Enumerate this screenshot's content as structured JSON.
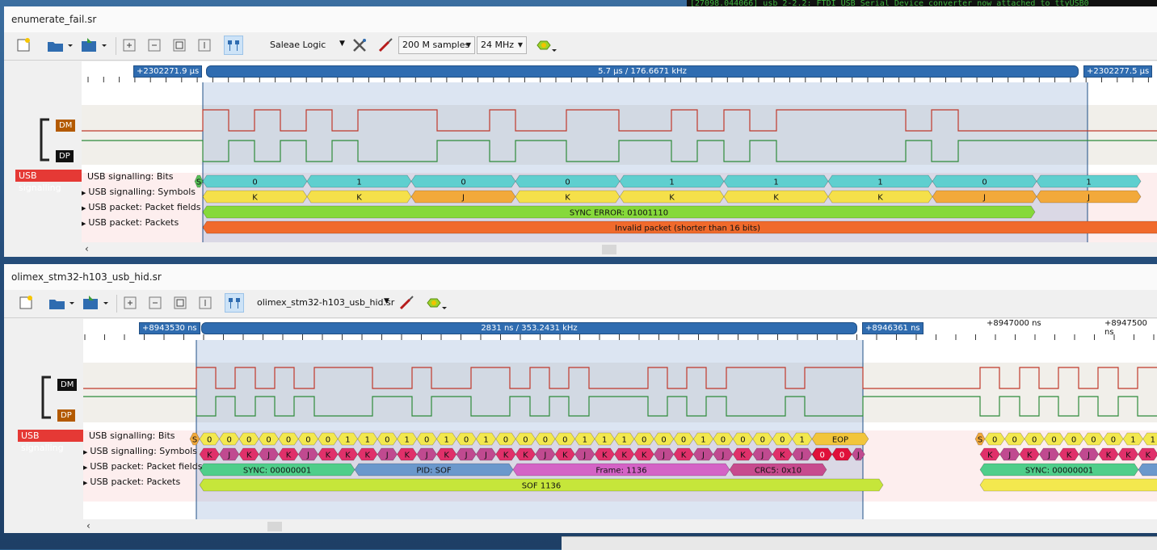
{
  "terminal_text": "[27098.044066] usb 2-2.2: FTDI USB Serial Device converter now attached to ttyUSB0",
  "colors": {
    "bit_fill": "#5fcfcf",
    "sym_k": "#f5e04a",
    "sym_j": "#f2a93b",
    "sync_error": "#86d93a",
    "invalid": "#f06a2c",
    "hid_bit": "#f3e84e",
    "hid_sym": "#c04a90",
    "hid_sym_alt": "#e0306a",
    "f_sync": "#4fce8a",
    "f_pid": "#6b98cc",
    "f_frame": "#d463c6",
    "f_crc": "#c74b8e",
    "f_sof": "#c6e63a",
    "dm_tag": "#b35a00",
    "dp_tag": "#111111",
    "usb_tag": "#e53935"
  },
  "win1": {
    "title": "enumerate_fail.sr",
    "device": "Saleae Logic",
    "samples": "200 M samples",
    "rate": "24 MHz",
    "marker_left": "+2302271.9 µs",
    "marker_mid": "5.7 µs / 176.6671 kHz",
    "marker_right": "+2302277.5 µs",
    "ch_dm": "DM",
    "ch_dp": "DP",
    "usb_tag": "USB signalling",
    "rows": [
      "USB signalling: Bits",
      "USB signalling: Symbols",
      "USB packet: Packet fields",
      "USB packet: Packets"
    ],
    "bits": [
      "0",
      "1",
      "0",
      "0",
      "1",
      "1",
      "1",
      "0",
      "1"
    ],
    "bits_start": "S",
    "symbols": [
      "K",
      "K",
      "J",
      "K",
      "K",
      "K",
      "K",
      "J",
      "J"
    ],
    "field": "SYNC ERROR: 01001110",
    "packet": "Invalid packet (shorter than 16 bits)"
  },
  "win2": {
    "title": "olimex_stm32-h103_usb_hid.sr",
    "session": "olimex_stm32-h103_usb_hid.sr",
    "marker_left": "+8943530 ns",
    "marker_mid": "2831 ns / 353.2431 kHz",
    "marker_right": "+8946361 ns",
    "tick1": "+8947000 ns",
    "tick2": "+8947500 ns",
    "ch_dm": "DM",
    "ch_dp": "DP",
    "usb_tag": "USB signalling",
    "rows": [
      "USB signalling: Bits",
      "USB signalling: Symbols",
      "USB packet: Packet fields",
      "USB packet: Packets"
    ],
    "bits": [
      "0",
      "0",
      "0",
      "0",
      "0",
      "0",
      "0",
      "1",
      "1",
      "0",
      "1",
      "0",
      "1",
      "0",
      "1",
      "0",
      "0",
      "0",
      "0",
      "1",
      "1",
      "1",
      "0",
      "0",
      "0",
      "1",
      "0",
      "0",
      "0",
      "0",
      "1"
    ],
    "bits_start": "S",
    "eop": "EOP",
    "symbols": [
      "K",
      "J",
      "K",
      "J",
      "K",
      "J",
      "K",
      "K",
      "K",
      "J",
      "K",
      "J",
      "K",
      "J",
      "J",
      "K",
      "K",
      "J",
      "K",
      "J",
      "K",
      "K",
      "K",
      "J",
      "K",
      "J",
      "J",
      "K",
      "J",
      "K",
      "J",
      "J"
    ],
    "sym_end": [
      "0",
      "0"
    ],
    "sym_last": "J",
    "fields": [
      "SYNC: 00000001",
      "PID: SOF",
      "Frame: 1136",
      "CRC5: 0x10"
    ],
    "packet": "SOF 1136",
    "bits2": [
      "0",
      "0",
      "0",
      "0",
      "0",
      "0",
      "0",
      "1",
      "1"
    ],
    "symbols2": [
      "K",
      "J",
      "K",
      "J",
      "K",
      "J",
      "K",
      "K",
      "K"
    ],
    "field2": "SYNC: 00000001"
  }
}
